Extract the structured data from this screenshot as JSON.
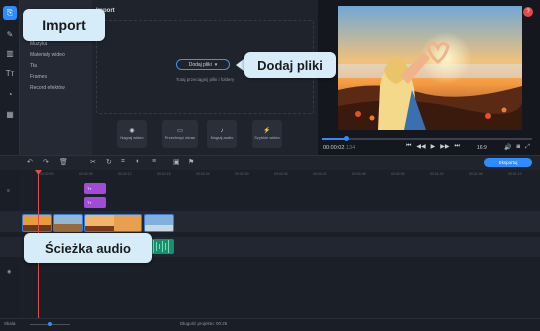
{
  "sidebar": {
    "icons": [
      {
        "name": "import-icon",
        "glyph": "⎘"
      },
      {
        "name": "filters-icon",
        "glyph": "✎"
      },
      {
        "name": "transitions-icon",
        "glyph": "▥"
      },
      {
        "name": "titles-icon",
        "glyph": "Tт"
      },
      {
        "name": "stickers-icon",
        "glyph": "◔"
      },
      {
        "name": "more-icon",
        "glyph": "▦"
      }
    ]
  },
  "categories": {
    "items": [
      "Muzyka",
      "Materiały wideo",
      "Tła",
      "Frames",
      "Record efektów"
    ]
  },
  "import_panel": {
    "title": "Import",
    "add_files_button": "Dodaj pliki",
    "drop_hint": "Tutaj przeciągnij pliki i foldery",
    "buttons": [
      {
        "label": "Nagraj wideo",
        "glyph": "◉"
      },
      {
        "label": "Przechwyć ekran",
        "glyph": "▭"
      },
      {
        "label": "Nagraj audio",
        "glyph": "♪"
      },
      {
        "label": "Szybkie wideo",
        "glyph": "⚡"
      }
    ]
  },
  "preview": {
    "timecode": "00:00:02",
    "timecode_suffix": ".134",
    "aspect_ratio": "16:9",
    "help_glyph": "?"
  },
  "toolbar": {
    "export_label": "Eksportuj"
  },
  "timeline": {
    "ruler_ticks": [
      "00:00:00",
      "00:00:06",
      "00:00:12",
      "00:00:18",
      "00:00:24",
      "00:00:30",
      "00:00:36",
      "00:00:42",
      "00:00:48",
      "00:00:54",
      "00:01:00",
      "00:01:06",
      "00:01:12"
    ],
    "text_clips": [
      "Tт",
      "Tт"
    ]
  },
  "status": {
    "scale_label": "Skala:",
    "duration_label": "Długość projektu:",
    "duration_value": "00:26"
  },
  "callouts": {
    "import": "Import",
    "add_files": "Dodaj pliki",
    "audio_track": "Ścieżka audio"
  },
  "colors": {
    "accent": "#2f8cff",
    "callout_bg": "#d6ecf8",
    "text_clip": "#a24bd6",
    "audio_clip": "#1e8c6f",
    "playhead": "#e04b4b"
  }
}
